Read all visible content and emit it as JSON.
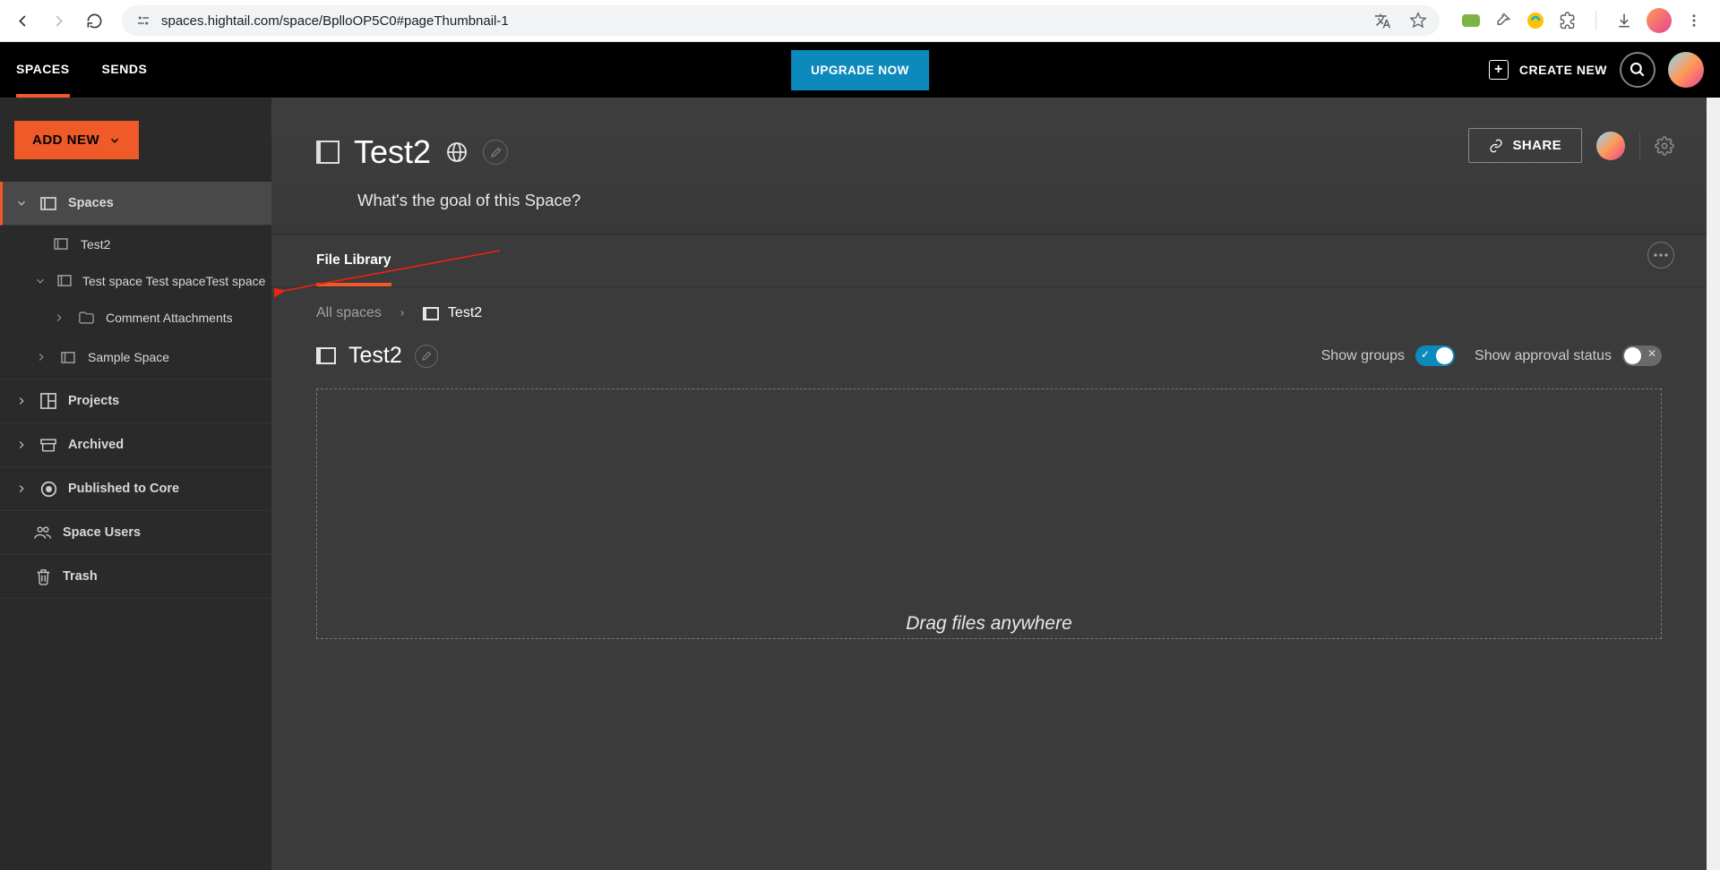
{
  "browser": {
    "url": "spaces.hightail.com/space/BplloOP5C0#pageThumbnail-1"
  },
  "topbar": {
    "tabs": {
      "spaces": "SPACES",
      "sends": "SENDS"
    },
    "upgrade": "UPGRADE NOW",
    "create_new": "CREATE NEW"
  },
  "sidebar": {
    "add_new": "ADD NEW",
    "nodes": {
      "spaces": "Spaces",
      "test2": "Test2",
      "testspace": "Test space Test spaceTest space",
      "comment_att": "Comment Attachments",
      "sample": "Sample Space",
      "projects": "Projects",
      "archived": "Archived",
      "published": "Published to Core",
      "users": "Space Users",
      "trash": "Trash"
    }
  },
  "header": {
    "title": "Test2",
    "goal": "What's the goal of this Space?",
    "share": "SHARE"
  },
  "tabs": {
    "file_library": "File Library"
  },
  "breadcrumb": {
    "root": "All spaces",
    "current": "Test2"
  },
  "section": {
    "title": "Test2"
  },
  "toggles": {
    "groups": "Show groups",
    "approval": "Show approval status"
  },
  "dropzone": {
    "text": "Drag files anywhere"
  }
}
